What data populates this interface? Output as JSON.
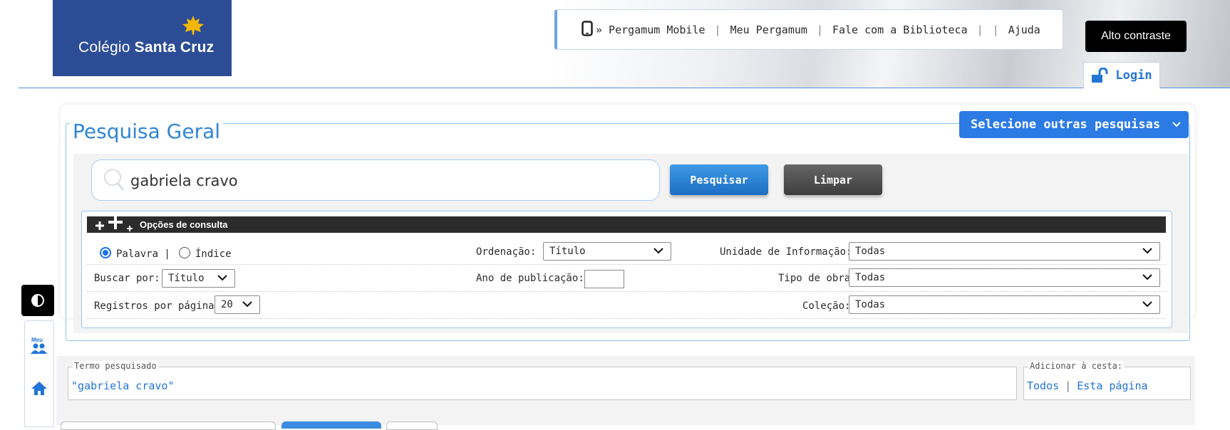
{
  "header": {
    "logo_text_light": "Colégio ",
    "logo_text_bold": "Santa Cruz",
    "nav": {
      "mobile": "» Pergamum Mobile",
      "meu": "Meu Pergamum",
      "fale": "Fale com a Biblioteca",
      "sep2": "|",
      "ajuda": "Ajuda"
    },
    "contrast_button": "Alto contraste",
    "login_button": "Login"
  },
  "side": {
    "meu_label": "Meu"
  },
  "search": {
    "title": "Pesquisa Geral",
    "other_searches_button": "Selecione outras pesquisas",
    "query_value": "gabriela cravo",
    "search_button": "Pesquisar",
    "clear_button": "Limpar"
  },
  "options": {
    "header": "Opções de consulta",
    "radio_palavra": "Palavra |",
    "radio_indice": "Índice",
    "buscar_por_label": "Buscar por:",
    "buscar_por_value": "Título",
    "registros_label": "Registros por página:",
    "registros_value": "20",
    "ordenacao_label": "Ordenação:",
    "ordenacao_value": "Título",
    "ano_label": "Ano de publicação:",
    "unidade_label": "Unidade de Informação:",
    "unidade_value": "Todas",
    "tipo_label": "Tipo de obra:",
    "tipo_value": "Todas",
    "colecao_label": "Coleção:",
    "colecao_value": "Todas"
  },
  "results": {
    "termo_legend": "Termo pesquisado",
    "termo_value": "\"gabriela cravo\"",
    "cesta_legend": "Adicionar à cesta:",
    "cesta_todos": "Todos",
    "cesta_sep": "|",
    "cesta_pagina": "Esta página"
  },
  "colors": {
    "accent_blue": "#2c7be5",
    "title_blue": "#2f85d8",
    "logo_bg": "#2c4d96",
    "dark_header": "#2c2c2c"
  }
}
